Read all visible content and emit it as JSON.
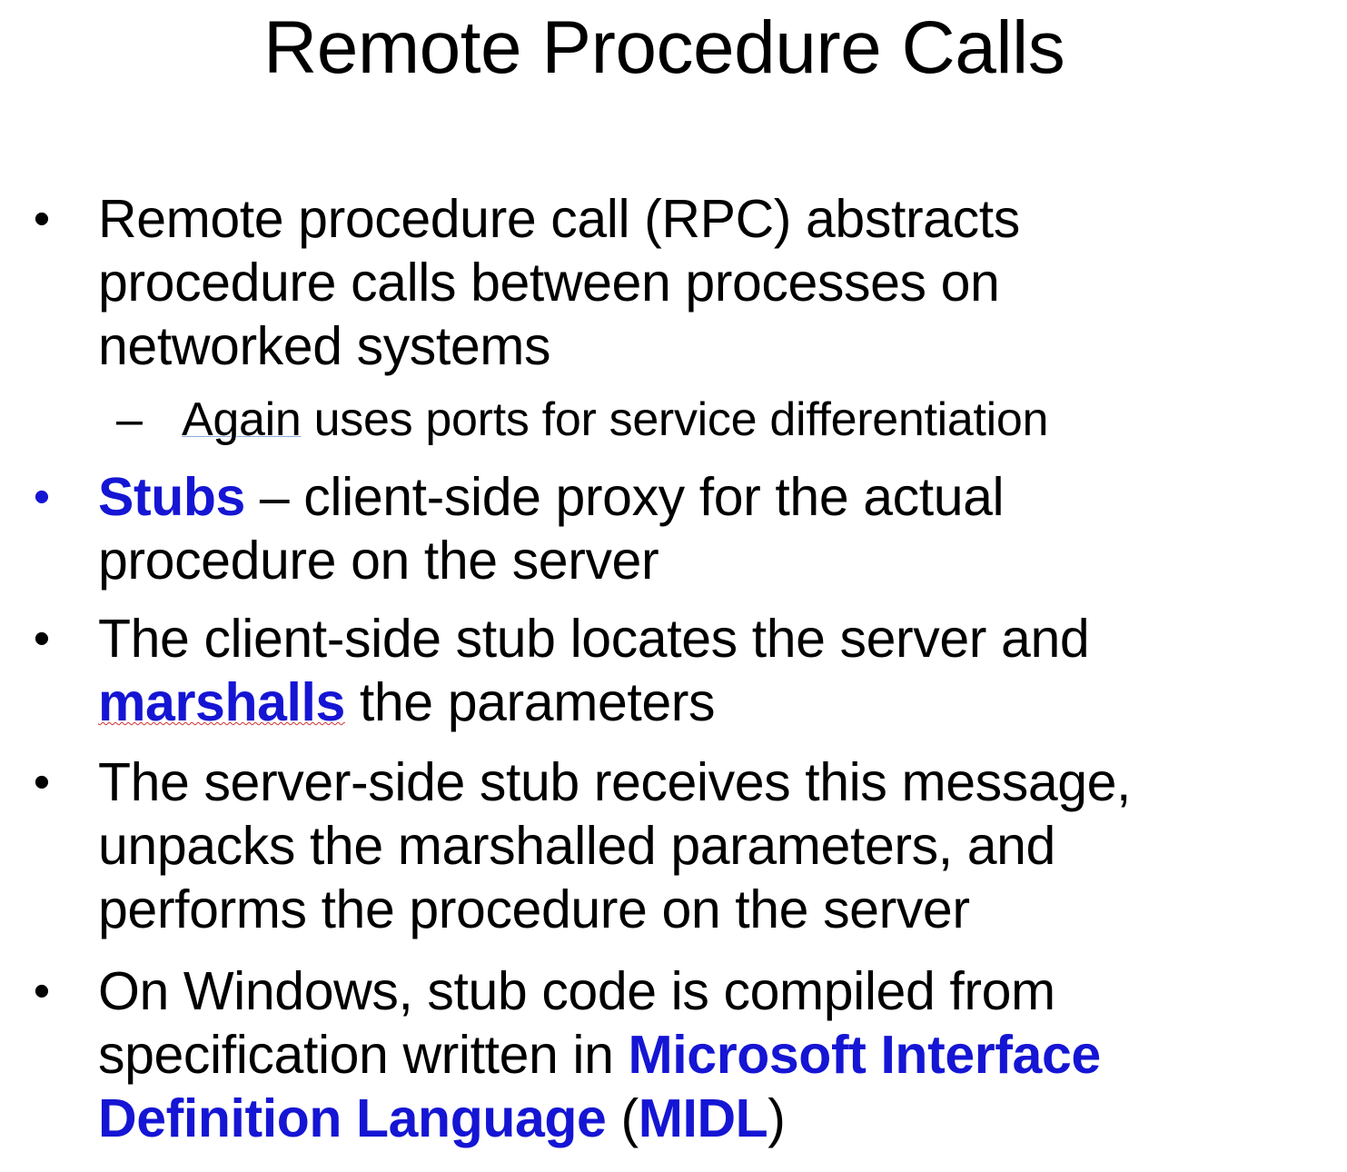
{
  "slide": {
    "title": "Remote Procedure Calls",
    "bullet_symbol": "•",
    "dash_symbol": "–",
    "accent_color": "#1515d4",
    "items": [
      {
        "text": "Remote procedure call (RPC) abstracts procedure calls between processes on networked systems",
        "line1": "Remote procedure call (RPC) abstracts",
        "line2": "procedure calls between processes on",
        "line3": "networked systems",
        "subitem": {
          "underlined": "Again",
          "rest": " uses ports for service differentiation"
        }
      },
      {
        "term": "Stubs",
        "line1_rest": " – client-side proxy for the actual",
        "line2": "procedure on the server"
      },
      {
        "line1": "The client-side stub locates the server and",
        "term": "marshalls",
        "line2_rest": " the parameters"
      },
      {
        "line1": "The server-side stub receives this message,",
        "line2": "unpacks the marshalled parameters, and",
        "line3": "performs the procedure on the server"
      },
      {
        "line1": "On Windows, stub code is compiled from",
        "line2_prefix": "specification written in ",
        "term1": "Microsoft Interface",
        "term2": "Definition Language",
        "paren_open": " (",
        "abbr": "MIDL",
        "paren_close": ")"
      }
    ]
  }
}
